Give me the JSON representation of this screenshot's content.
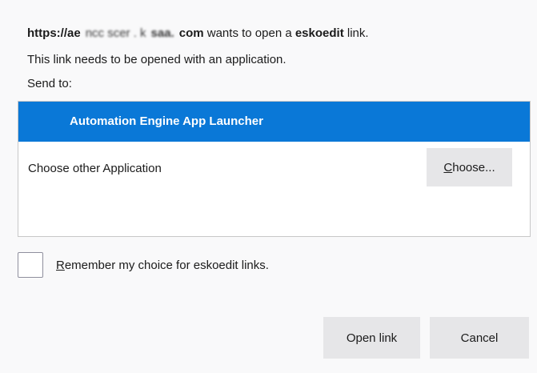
{
  "header": {
    "url_start": "https://ae",
    "url_obscured": "ncc  scer  .  k",
    "url_mid": "saa.",
    "url_end": "com",
    "wants_text": " wants to open a ",
    "scheme": "eskoedit",
    "link_text": " link."
  },
  "info_text": "This link needs to be opened with an application.",
  "send_to_label": "Send to:",
  "app_list": {
    "selected_app": "Automation Engine App Launcher",
    "other_label": "Choose other Application",
    "choose_button": {
      "accel": "C",
      "rest": "hoose..."
    }
  },
  "remember": {
    "checked": false,
    "accel": "R",
    "rest": "emember my choice for eskoedit links."
  },
  "buttons": {
    "open_link": "Open link",
    "cancel": "Cancel"
  },
  "colors": {
    "selection": "#0a78d7",
    "button_bg": "#e6e6e8",
    "dialog_bg": "#f9f9fa"
  }
}
